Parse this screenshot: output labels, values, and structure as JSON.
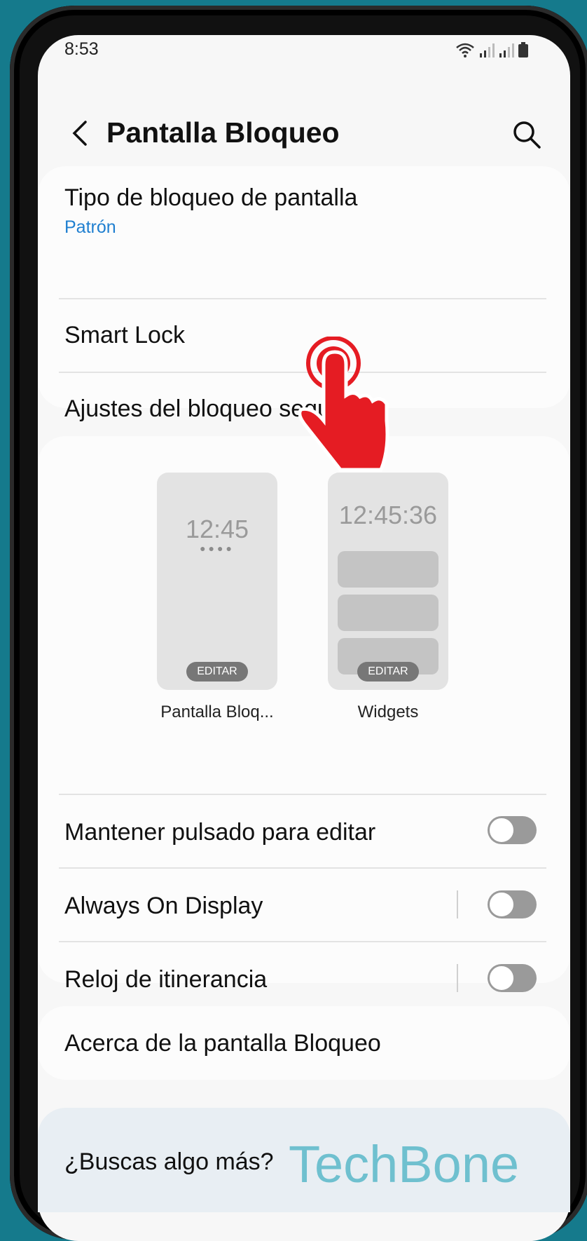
{
  "status_bar": {
    "time": "8:53"
  },
  "header": {
    "title": "Pantalla Bloqueo"
  },
  "security_card": {
    "screen_lock_type": {
      "label": "Tipo de bloqueo de pantalla",
      "value": "Patrón"
    },
    "smart_lock": {
      "label": "Smart Lock"
    },
    "secure_lock_settings": {
      "label": "Ajustes del bloqueo seguridad"
    }
  },
  "previews": {
    "lock": {
      "time": "12:45",
      "dots": "●●●●",
      "edit_label": "EDITAR",
      "caption": "Pantalla Bloq..."
    },
    "widgets": {
      "time": "12:45:36",
      "edit_label": "EDITAR",
      "caption": "Widgets"
    }
  },
  "toggles": [
    {
      "label": "Mantener pulsado para editar",
      "on": false
    },
    {
      "label": "Always On Display",
      "on": false
    },
    {
      "label": "Reloj de itinerancia",
      "on": false
    }
  ],
  "about": {
    "label": "Acerca de la pantalla Bloqueo"
  },
  "more": {
    "label": "¿Buscas algo más?"
  },
  "watermark": "TechBone",
  "colors": {
    "accent_blue": "#1f7fd0",
    "background_teal": "#157a8c",
    "tap_red": "#e51c23"
  }
}
